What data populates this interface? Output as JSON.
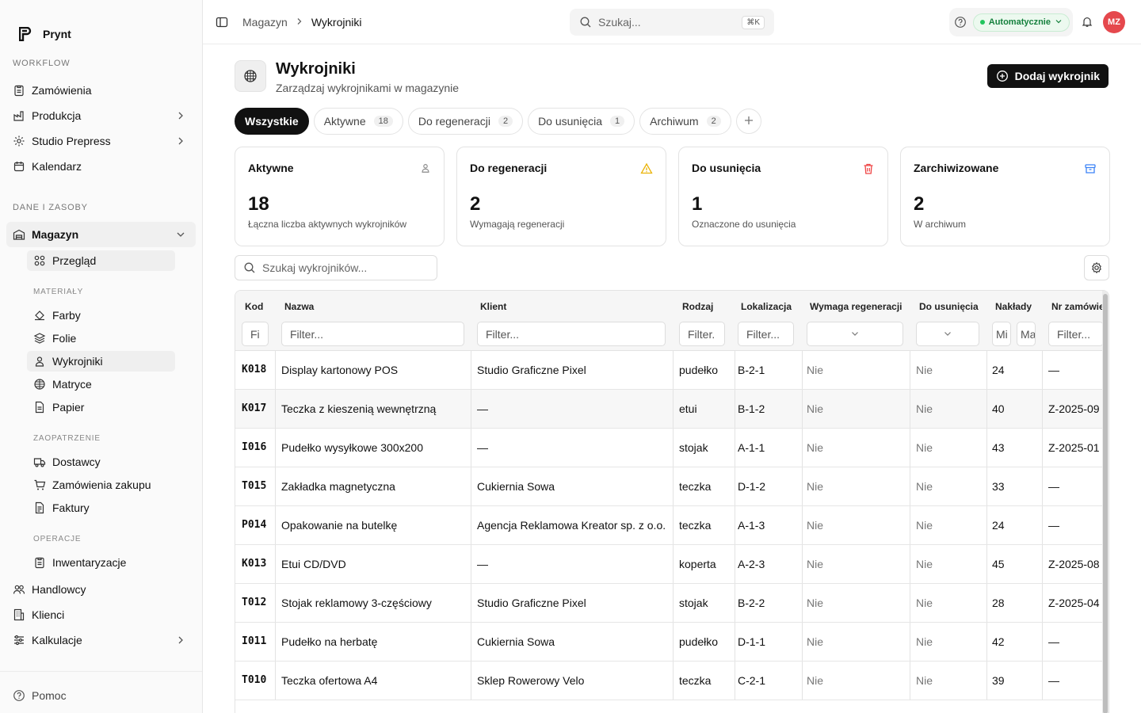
{
  "brand": {
    "name": "Prynt"
  },
  "sidebar": {
    "workflow_label": "WORKFLOW",
    "workflow": [
      {
        "label": "Zamówienia"
      },
      {
        "label": "Produkcja"
      },
      {
        "label": "Studio Prepress"
      },
      {
        "label": "Kalendarz"
      }
    ],
    "data_label": "DANE I ZASOBY",
    "magazyn": {
      "label": "Magazyn"
    },
    "przeglad": {
      "label": "Przegląd"
    },
    "materialy_label": "MATERIAŁY",
    "materialy": [
      {
        "label": "Farby"
      },
      {
        "label": "Folie"
      },
      {
        "label": "Wykrojniki"
      },
      {
        "label": "Matryce"
      },
      {
        "label": "Papier"
      }
    ],
    "zaopatrzenie_label": "ZAOPATRZENIE",
    "zaopatrzenie": [
      {
        "label": "Dostawcy"
      },
      {
        "label": "Zamówienia zakupu"
      },
      {
        "label": "Faktury"
      }
    ],
    "operacje_label": "OPERACJE",
    "operacje": [
      {
        "label": "Inwentaryzacje"
      }
    ],
    "bottom": [
      {
        "label": "Handlowcy"
      },
      {
        "label": "Klienci"
      },
      {
        "label": "Kalkulacje"
      }
    ],
    "help": "Pomoc"
  },
  "topbar": {
    "crumb1": "Magazyn",
    "crumb2": "Wykrojniki",
    "search_placeholder": "Szukaj...",
    "shortcut": "⌘K",
    "mode": "Automatycznie",
    "avatar": "MZ"
  },
  "page": {
    "title": "Wykrojniki",
    "subtitle": "Zarządzaj wykrojnikami w magazynie",
    "add_button": "Dodaj wykrojnik"
  },
  "tabs": [
    {
      "label": "Wszystkie",
      "count": ""
    },
    {
      "label": "Aktywne",
      "count": "18"
    },
    {
      "label": "Do regeneracji",
      "count": "2"
    },
    {
      "label": "Do usunięcia",
      "count": "1"
    },
    {
      "label": "Archiwum",
      "count": "2"
    }
  ],
  "cards": [
    {
      "title": "Aktywne",
      "value": "18",
      "desc": "Łączna liczba aktywnych wykrojników",
      "color": "#888888"
    },
    {
      "title": "Do regeneracji",
      "value": "2",
      "desc": "Wymagają regeneracji",
      "color": "#eab308"
    },
    {
      "title": "Do usunięcia",
      "value": "1",
      "desc": "Oznaczone do usunięcia",
      "color": "#ef4444"
    },
    {
      "title": "Zarchiwizowane",
      "value": "2",
      "desc": "W archiwum",
      "color": "#3b82f6"
    }
  ],
  "table_search_placeholder": "Szukaj wykrojników...",
  "table": {
    "headers": {
      "kod": "Kod",
      "nazwa": "Nazwa",
      "klient": "Klient",
      "rodzaj": "Rodzaj",
      "lokalizacja": "Lokalizacja",
      "regen": "Wymaga regeneracji",
      "usun": "Do usunięcia",
      "naklady": "Nakłady",
      "nr": "Nr zamówie"
    },
    "filters": {
      "kod": "Fi",
      "nazwa": "Filter...",
      "klient": "Filter...",
      "rodzaj": "Filter.",
      "lokalizacja": "Filter...",
      "naklady_min": "Mi",
      "naklady_max": "Ma",
      "nr": "Filter..."
    },
    "rows": [
      {
        "kod": "K018",
        "nazwa": "Display kartonowy POS",
        "klient": "Studio Graficzne Pixel",
        "rodzaj": "pudełko",
        "lok": "B-2-1",
        "regen": "Nie",
        "usun": "Nie",
        "naklady": "24",
        "nr": "—"
      },
      {
        "kod": "K017",
        "nazwa": "Teczka z kieszenią wewnętrzną",
        "klient": "—",
        "rodzaj": "etui",
        "lok": "B-1-2",
        "regen": "Nie",
        "usun": "Nie",
        "naklady": "40",
        "nr": "Z-2025-09"
      },
      {
        "kod": "I016",
        "nazwa": "Pudełko wysyłkowe 300x200",
        "klient": "—",
        "rodzaj": "stojak",
        "lok": "A-1-1",
        "regen": "Nie",
        "usun": "Nie",
        "naklady": "43",
        "nr": "Z-2025-01"
      },
      {
        "kod": "T015",
        "nazwa": "Zakładka magnetyczna",
        "klient": "Cukiernia Sowa",
        "rodzaj": "teczka",
        "lok": "D-1-2",
        "regen": "Nie",
        "usun": "Nie",
        "naklady": "33",
        "nr": "—"
      },
      {
        "kod": "P014",
        "nazwa": "Opakowanie na butelkę",
        "klient": "Agencja Reklamowa Kreator sp. z o.o.",
        "rodzaj": "teczka",
        "lok": "A-1-3",
        "regen": "Nie",
        "usun": "Nie",
        "naklady": "24",
        "nr": "—"
      },
      {
        "kod": "K013",
        "nazwa": "Etui CD/DVD",
        "klient": "—",
        "rodzaj": "koperta",
        "lok": "A-2-3",
        "regen": "Nie",
        "usun": "Nie",
        "naklady": "45",
        "nr": "Z-2025-08"
      },
      {
        "kod": "T012",
        "nazwa": "Stojak reklamowy 3-częściowy",
        "klient": "Studio Graficzne Pixel",
        "rodzaj": "stojak",
        "lok": "B-2-2",
        "regen": "Nie",
        "usun": "Nie",
        "naklady": "28",
        "nr": "Z-2025-04"
      },
      {
        "kod": "I011",
        "nazwa": "Pudełko na herbatę",
        "klient": "Cukiernia Sowa",
        "rodzaj": "pudełko",
        "lok": "D-1-1",
        "regen": "Nie",
        "usun": "Nie",
        "naklady": "42",
        "nr": "—"
      },
      {
        "kod": "T010",
        "nazwa": "Teczka ofertowa A4",
        "klient": "Sklep Rowerowy Velo",
        "rodzaj": "teczka",
        "lok": "C-2-1",
        "regen": "Nie",
        "usun": "Nie",
        "naklady": "39",
        "nr": "—"
      }
    ]
  }
}
